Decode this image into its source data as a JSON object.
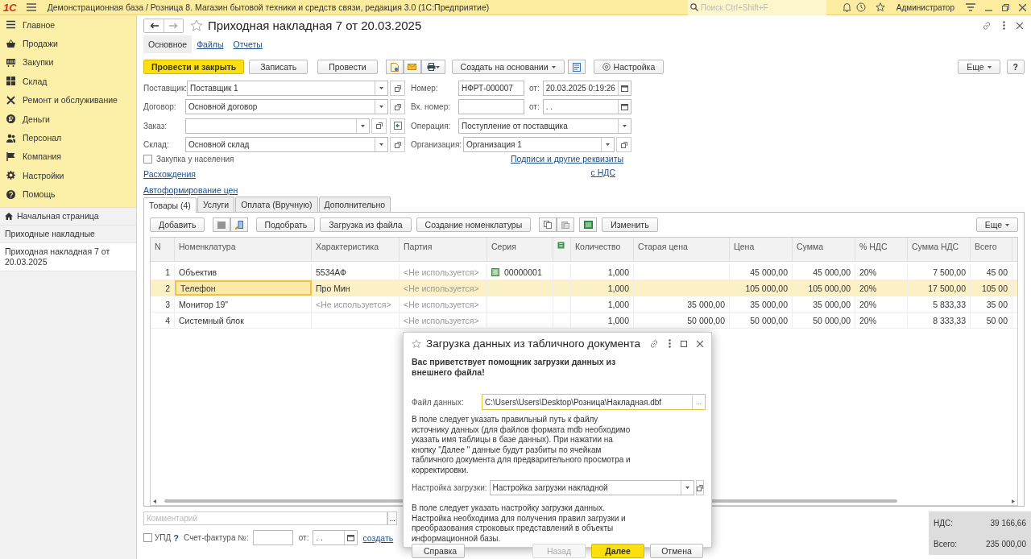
{
  "titlebar": {
    "logo": "1С",
    "app_title": "Демонстрационная база / Розница 8. Магазин бытовой техники и средств связи, редакция 3.0  (1С:Предприятие)",
    "search": {
      "placeholder": "Поиск Ctrl+Shift+F"
    },
    "user": "Администратор"
  },
  "sidebar": {
    "items": [
      {
        "label": "Главное"
      },
      {
        "label": "Продажи"
      },
      {
        "label": "Закупки"
      },
      {
        "label": "Склад"
      },
      {
        "label": "Ремонт и обслуживание"
      },
      {
        "label": "Деньги"
      },
      {
        "label": "Персонал"
      },
      {
        "label": "Компания"
      },
      {
        "label": "Настройки"
      },
      {
        "label": "Помощь"
      }
    ],
    "open_windows": [
      {
        "label": "Начальная страница",
        "kind": "home",
        "selected": false
      },
      {
        "label": "Приходные накладные",
        "kind": "list",
        "selected": false
      },
      {
        "label": "Приходная накладная 7 от 20.03.2025",
        "kind": "list",
        "selected": true
      }
    ]
  },
  "document": {
    "title": "Приходная накладная 7 от 20.03.2025",
    "nav_tabs": [
      {
        "label": "Основное",
        "selected": true
      },
      {
        "label": "Файлы",
        "selected": false
      },
      {
        "label": "Отчеты",
        "selected": false
      }
    ],
    "toolbar": {
      "buttons": [
        {
          "label": "Провести и закрыть",
          "kind": "primary"
        },
        {
          "label": "Записать",
          "kind": "plain"
        },
        {
          "label": "Провести",
          "kind": "plain"
        }
      ],
      "create_based_on": "Создать на основании",
      "settings": "Настройка",
      "more": "Еще",
      "help": "?"
    },
    "fields_left": [
      {
        "label": "Поставщик:",
        "value": "Поставщик 1",
        "kind": "select"
      },
      {
        "label": "Договор:",
        "value": "Основной договор",
        "kind": "select"
      },
      {
        "label": "Заказ:",
        "kind": "select_extra"
      },
      {
        "label": "Склад:",
        "value": "Основной склад",
        "kind": "select"
      }
    ],
    "fields_right": [
      {
        "label": "Номер:",
        "value": "НФРТ-000007",
        "kind": "number",
        "date_label": "от:",
        "date": "20.03.2025  0:19:26"
      },
      {
        "label": "Вх. номер:",
        "kind": "number",
        "date_label": "от:",
        "date": " .  . "
      },
      {
        "label": "Операция:",
        "value": "Поступление от поставщика",
        "kind": "dropdown"
      },
      {
        "label": "Организация:",
        "value": "Организация 1",
        "kind": "select"
      }
    ],
    "purchase_from_public": {
      "label": "Закупка у населения",
      "checked": false
    },
    "links_left": [
      "Расхождения",
      "Автоформирование цен"
    ],
    "links_right": [
      "Подписи и другие реквизиты",
      "с НДС"
    ],
    "tabs": [
      {
        "label": "Товары (4)",
        "selected": true
      },
      {
        "label": "Услуги",
        "selected": false
      },
      {
        "label": "Оплата (Вручную)",
        "selected": false
      },
      {
        "label": "Дополнительно",
        "selected": false
      }
    ],
    "table_toolbar": {
      "add": "Добавить",
      "pick": "Подобрать",
      "load": "Загрузка из файла",
      "create": "Создание номенклатуры",
      "edit": "Изменить",
      "more": "Еще"
    },
    "table": {
      "columns": [
        {
          "title": "N"
        },
        {
          "title": "Номенклатура"
        },
        {
          "title": "Характеристика"
        },
        {
          "title": "Партия"
        },
        {
          "title": "Серия"
        },
        {
          "kind": "icon"
        },
        {
          "title": "Количество"
        },
        {
          "title": "Старая цена"
        },
        {
          "title": "Цена"
        },
        {
          "title": "Сумма"
        },
        {
          "title": "% НДС"
        },
        {
          "title": "Сумма НДС"
        },
        {
          "title": "Всего"
        }
      ],
      "rows": [
        {
          "selected": false,
          "cells": [
            "1",
            "Объектив",
            "5534АФ",
            {
              "text": "<Не используется>",
              "muted": true
            },
            "00000001",
            "",
            "1,000",
            "",
            "45 000,00",
            "45 000,00",
            "20%",
            "7 500,00",
            "45 00"
          ]
        },
        {
          "selected": true,
          "cells": [
            "2",
            "Телефон",
            "Про Мин",
            {
              "text": "<Не используется>",
              "muted": true
            },
            "",
            "",
            "1,000",
            "",
            "105 000,00",
            "105 000,00",
            "20%",
            "17 500,00",
            "105 00"
          ]
        },
        {
          "selected": false,
          "cells": [
            "3",
            "Монитор 19\"",
            {
              "text": "<Не используется>",
              "muted": true
            },
            {
              "text": "<Не используется>",
              "muted": true
            },
            "",
            "",
            "1,000",
            "35 000,00",
            "35 000,00",
            "35 000,00",
            "20%",
            "5 833,33",
            "35 00"
          ]
        },
        {
          "selected": false,
          "cells": [
            "4",
            "Системный блок",
            "",
            {
              "text": "<Не используется>",
              "muted": true
            },
            "",
            "",
            "1,000",
            "50 000,00",
            "50 000,00",
            "50 000,00",
            "20%",
            "8 333,33",
            "50 00"
          ]
        }
      ]
    },
    "comment": {
      "placeholder": "Комментарий",
      "button": "..."
    },
    "upd": {
      "label": "УПД",
      "checked": false,
      "help": "?"
    },
    "invoice": {
      "label": "Счет-фактура №:",
      "date_label": "от:",
      "date": " .  . ",
      "link": "создать"
    },
    "totals": [
      {
        "label": "НДС:",
        "value": "39 166,66"
      },
      {
        "label": "Всего:",
        "value": "235 000,00"
      }
    ]
  },
  "dialog": {
    "title": "Загрузка данных из табличного документа",
    "intro": "Вас приветствует помощник загрузки данных из внешнего файла!",
    "file": {
      "label": "Файл данных:",
      "value": "C:\\Users\\Users\\Desktop\\Розница\\Накладная.dbf",
      "button": "..."
    },
    "hint1": "В поле следует указать правильный путь к файлу источнику данных (для файлов формата mdb необходимо указать имя таблицы в базе данных). При нажатии на кнопку \"Далее \" данные будут разбиты по ячейкам табличного документа для предварительного просмотра и корректировки.",
    "setting": {
      "label": "Настройка загрузки:",
      "value": "Настройка загрузки накладной"
    },
    "hint2": "В поле следует указать настройку загрузки данных. Настройка необходима для получения правил загрузки и преобразования строковых представлений в объекты информационной базы.",
    "buttons": [
      {
        "label": "Справка",
        "kind": "help",
        "disabled": false
      },
      {
        "label": "Назад",
        "kind": "plain",
        "disabled": true
      },
      {
        "label": "Далее",
        "kind": "primary",
        "disabled": false
      },
      {
        "label": "Отмена",
        "kind": "plain",
        "disabled": false
      }
    ]
  }
}
